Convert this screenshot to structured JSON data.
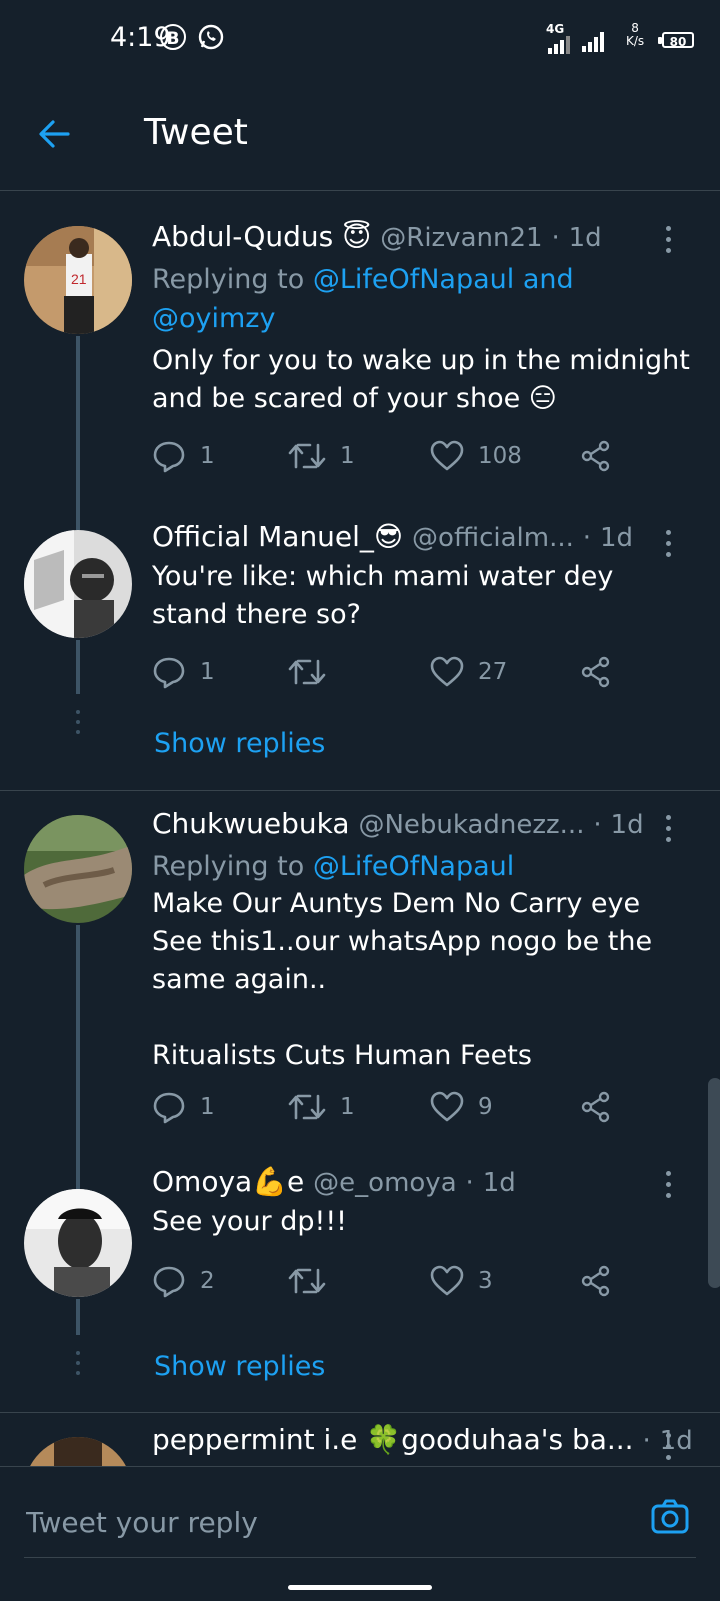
{
  "status_bar": {
    "time": "4:19",
    "network": "4G",
    "speed_value": "8",
    "speed_unit": "K/s",
    "battery": "80"
  },
  "header": {
    "title": "Tweet"
  },
  "tweets": [
    {
      "name": "Abdul-Qudus 😇",
      "handle": "@Rizvann21",
      "time": "1d",
      "replying_prefix": "Replying to ",
      "replying_to": "@LifeOfNapaul and @oyimzy",
      "text": "Only for you to wake up in the midnight and be scared of your shoe 😑",
      "replies": "1",
      "retweets": "1",
      "likes": "108"
    },
    {
      "name": "Official Manuel_😎",
      "handle": "@officialm...",
      "time": "1d",
      "text": "You're like: which mami water dey stand there so?",
      "replies": "1",
      "retweets": "",
      "likes": "27",
      "show_replies": "Show replies"
    },
    {
      "name": "Chukwuebuka",
      "handle": "@Nebukadnezz...",
      "time": "1d",
      "replying_prefix": "Replying to ",
      "replying_to": "@LifeOfNapaul",
      "text": "Make Our Auntys Dem No Carry eye\nSee this1..our whatsApp nogo be the same again..\n\nRitualists Cuts Human Feets",
      "replies": "1",
      "retweets": "1",
      "likes": "9"
    },
    {
      "name": "Omoya💪e",
      "handle": "@e_omoya",
      "time": "1d",
      "text": "See your dp!!!",
      "replies": "2",
      "retweets": "",
      "likes": "3",
      "show_replies": "Show replies"
    },
    {
      "name": "peppermint i.e 🍀gooduhaa's ba...",
      "handle": "",
      "time": "1d"
    }
  ],
  "reply_bar": {
    "placeholder": "Tweet your reply"
  },
  "colors": {
    "background": "#15202b",
    "accent": "#1da1f2",
    "muted": "#8899a6",
    "divider": "#38444d"
  }
}
